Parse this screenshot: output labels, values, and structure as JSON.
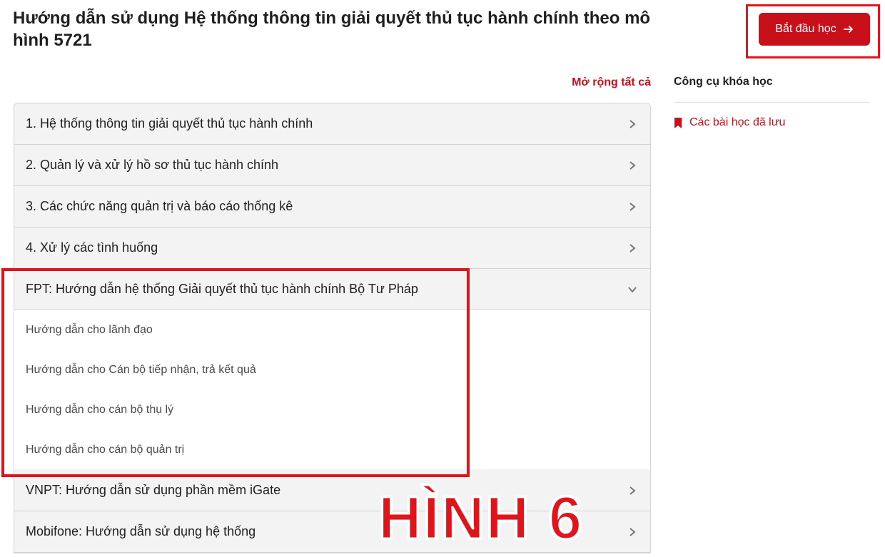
{
  "course": {
    "title": "Hướng dẫn sử dụng Hệ thống thông tin giải quyết thủ tục hành chính theo mô hình 5721",
    "start_label": "Bắt đầu học"
  },
  "outline": {
    "expand_all_label": "Mở rộng tất cả",
    "modules": [
      {
        "label": "1. Hệ thống thông tin giải quyết thủ tục hành chính",
        "expanded": false
      },
      {
        "label": "2. Quản lý và xử lý hồ sơ thủ tục hành chính",
        "expanded": false
      },
      {
        "label": "3. Các chức năng quản trị và báo cáo thống kê",
        "expanded": false
      },
      {
        "label": "4. Xử lý các tình huống",
        "expanded": false
      },
      {
        "label": "FPT: Hướng dẫn hệ thống Giải quyết thủ tục hành chính Bộ Tư Pháp",
        "expanded": true,
        "lessons": [
          "Hướng dẫn cho lãnh đạo",
          "Hướng dẫn cho Cán bộ tiếp nhận, trả kết quả",
          "Hướng dẫn cho cán bộ thụ lý",
          "Hướng dẫn cho cán bộ quản trị"
        ]
      },
      {
        "label": "VNPT: Hướng dẫn sử dụng phần mềm iGate",
        "expanded": false
      },
      {
        "label": "Mobifone: Hướng dẫn sử dụng hệ thống",
        "expanded": false
      }
    ]
  },
  "sidebar": {
    "title": "Công cụ khóa học",
    "saved_lessons_label": "Các bài học đã lưu"
  },
  "annotation": {
    "label": "HÌNH 6"
  },
  "colors": {
    "brand_red": "#c8101a",
    "annotation_red": "#e0151b",
    "row_bg": "#f3f3f3"
  },
  "icons": {
    "start": "arrow-right-icon",
    "collapsed": "chevron-right-icon",
    "expanded": "chevron-down-icon",
    "saved": "bookmark-icon"
  }
}
